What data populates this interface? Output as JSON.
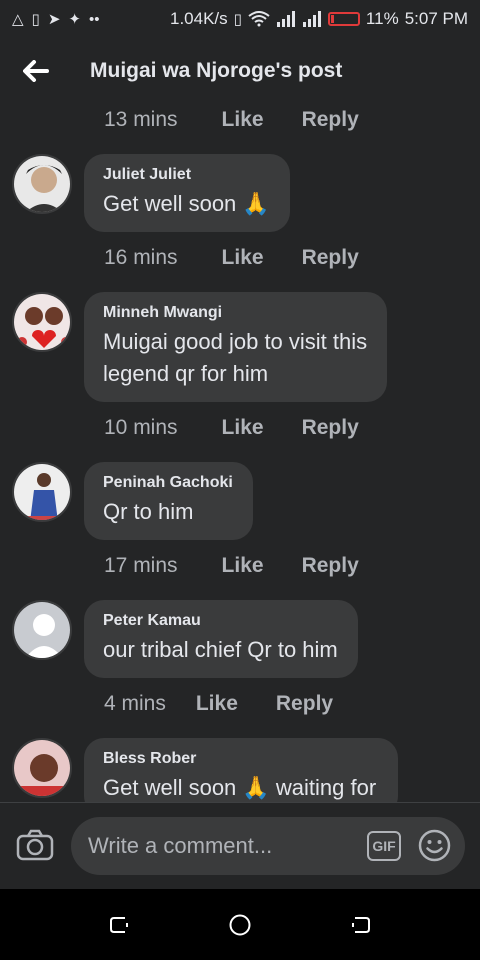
{
  "status_bar": {
    "network_speed": "1.04K/s",
    "battery_percent": "11%",
    "time": "5:07 PM",
    "icons": [
      "alert-icon",
      "notification-icon",
      "telegram-icon",
      "twitter-icon",
      "more-dots-icon",
      "vibrate-icon",
      "wifi-icon",
      "signal-icon",
      "signal-icon",
      "battery-low-icon"
    ]
  },
  "header": {
    "title": "Muigai wa Njoroge's post"
  },
  "comments": [
    {
      "time": "13 mins",
      "like": "Like",
      "reply": "Reply"
    },
    {
      "author": "Juliet Juliet",
      "text": "Get well soon 🙏",
      "time": "16 mins",
      "like": "Like",
      "reply": "Reply",
      "avatar_colors": [
        "#555",
        "#ddd"
      ]
    },
    {
      "author": "Minneh Mwangi",
      "text_line1": "Muigai good job to visit this",
      "text_line2": "legend qr for him",
      "time": "10 mins",
      "like": "Like",
      "reply": "Reply",
      "avatar_colors": [
        "#c44",
        "#eee"
      ]
    },
    {
      "author": "Peninah Gachoki",
      "text": "Qr to him",
      "time": "17 mins",
      "like": "Like",
      "reply": "Reply",
      "avatar_colors": [
        "#345ab0",
        "#ddd"
      ]
    },
    {
      "author": "Peter Kamau",
      "text": "our tribal chief Qr to him",
      "time": "4 mins",
      "like": "Like",
      "reply": "Reply",
      "avatar_colors": [
        "#c8cbd0",
        "#ffffff"
      ]
    },
    {
      "author": "Bless Rober",
      "text": "Get well soon 🙏 waiting for",
      "avatar_colors": [
        "#b33",
        "#a77"
      ]
    }
  ],
  "composer": {
    "placeholder": "Write a comment...",
    "gif_label": "GIF"
  },
  "colors": {
    "background": "#242526",
    "bubble": "#3a3b3c",
    "text_primary": "#e4e6eb",
    "text_secondary": "#b0b3b8"
  }
}
